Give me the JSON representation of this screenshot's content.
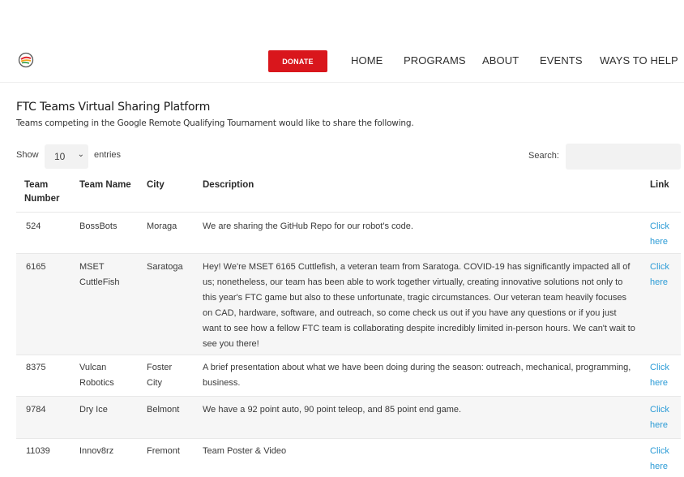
{
  "header": {
    "donate_label": "DONATE",
    "nav": [
      "HOME",
      "PROGRAMS",
      "ABOUT",
      "EVENTS",
      "WAYS TO HELP"
    ]
  },
  "intro": {
    "title": "FTC Teams Virtual Sharing Platform",
    "subtitle": "Teams competing in the Google Remote Qualifying Tournament would like to share the following."
  },
  "controls": {
    "show_label": "Show",
    "entries_value": "10",
    "entries_label": "entries",
    "search_label": "Search:",
    "search_value": ""
  },
  "table": {
    "headers": {
      "team_number": [
        "Team",
        "Number"
      ],
      "team_name": "Team Name",
      "city": "City",
      "description": "Description",
      "link": "Link"
    },
    "link_text": [
      "Click",
      "here"
    ],
    "rows": [
      {
        "number": "524",
        "name": [
          "BossBots"
        ],
        "city": [
          "Moraga"
        ],
        "description": "We are sharing the GitHub Repo for our robot's code."
      },
      {
        "number": "6165",
        "name": [
          "MSET",
          "CuttleFish"
        ],
        "city": [
          "Saratoga"
        ],
        "description": "Hey! We're MSET 6165 Cuttlefish, a veteran team from Saratoga. COVID-19 has significantly impacted all of us; nonetheless, our team has been able to work together virtually, creating innovative solutions not only to this year's FTC game but also to these unfortunate, tragic circumstances. Our veteran team heavily focuses on CAD, hardware, software, and outreach, so come check us out if you have any questions or if you just want to see how a fellow FTC team is collaborating despite incredibly limited in-person hours. We can't wait to see you there!"
      },
      {
        "number": "8375",
        "name": [
          "Vulcan",
          "Robotics"
        ],
        "city": [
          "Foster",
          "City"
        ],
        "description": "A brief presentation about what we have been doing during the season: outreach, mechanical, programming, business."
      },
      {
        "number": "9784",
        "name": [
          "Dry Ice"
        ],
        "city": [
          "Belmont"
        ],
        "description": "We have a 92 point auto, 90 point teleop, and 85 point end game."
      },
      {
        "number": "11039",
        "name": [
          "Innov8rz"
        ],
        "city": [
          "Fremont"
        ],
        "description": "Team Poster & Video"
      }
    ]
  }
}
